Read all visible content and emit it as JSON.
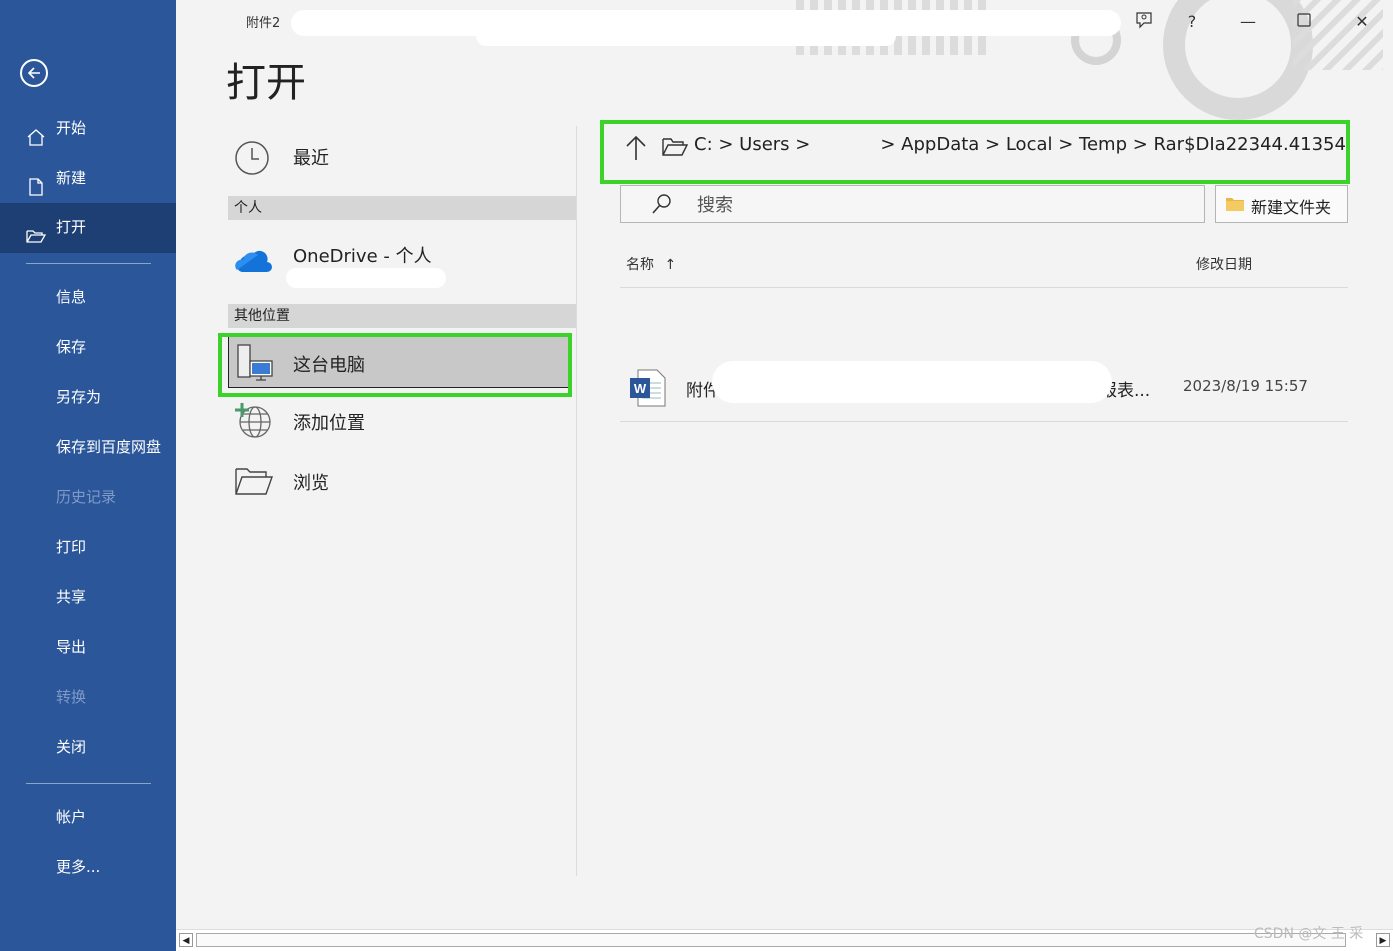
{
  "window": {
    "doc_title": "附件2",
    "help_label": "?",
    "minimize_label": "—",
    "close_label": "✕"
  },
  "page_title": "打开",
  "sidebar": {
    "items": [
      {
        "label": "开始"
      },
      {
        "label": "新建"
      },
      {
        "label": "打开"
      },
      {
        "label": "信息"
      },
      {
        "label": "保存"
      },
      {
        "label": "另存为"
      },
      {
        "label": "保存到百度网盘"
      },
      {
        "label": "历史记录"
      },
      {
        "label": "打印"
      },
      {
        "label": "共享"
      },
      {
        "label": "导出"
      },
      {
        "label": "转换"
      },
      {
        "label": "关闭"
      },
      {
        "label": "帐户"
      },
      {
        "label": "更多..."
      }
    ]
  },
  "places": {
    "recent": "最近",
    "section_personal": "个人",
    "onedrive": "OneDrive - 个人",
    "section_other": "其他位置",
    "this_pc": "这台电脑",
    "add_place": "添加位置",
    "browse": "浏览"
  },
  "breadcrumb": {
    "path_start": "C:  >  Users  >",
    "path_end": ">  AppData  >  Local  >  Temp  >  Rar$DIa22344.41354"
  },
  "search": {
    "placeholder": "搜索"
  },
  "new_folder_label": "新建文件夹",
  "columns": {
    "name": "名称",
    "sort_arrow": "↑",
    "modified": "修改日期"
  },
  "files": [
    {
      "name_start": "附件",
      "name_end": "报表...",
      "date": "2023/8/19 15:57"
    }
  ],
  "watermark": "CSDN @文 王 采"
}
